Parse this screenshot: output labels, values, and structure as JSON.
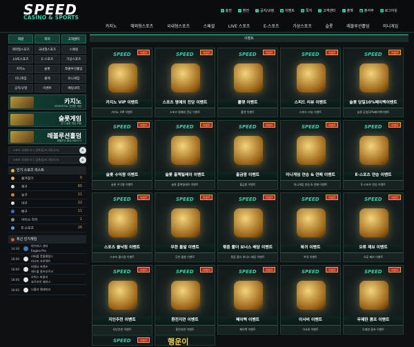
{
  "logo": {
    "main": "SPEED",
    "sub": "CASINO & SPORTS"
  },
  "top_menu": [
    "충전",
    "환전",
    "공지/규정",
    "이벤트",
    "쪽지",
    "고객센터",
    "출첵",
    "출석부",
    "로그아웃"
  ],
  "nav": [
    "카지노",
    "해외형스포츠",
    "국내형스포츠",
    "스페셜",
    "LIVE 스포츠",
    "E-스포츠",
    "가상스포츠",
    "슬롯",
    "레볼루션홀덤",
    "미니게임"
  ],
  "sidebar": {
    "top_buttons": [
      "회원",
      "쪽지",
      "고객센터"
    ],
    "grid": [
      "해외형스포츠",
      "국내형스포츠",
      "스페셜",
      "LIVE스포츠",
      "E-스포츠",
      "가상스포츠",
      "카지노",
      "슬롯",
      "레볼루션홀덤",
      "미니게임",
      "출첵",
      "미니게임",
      "공지/규정",
      "이벤트",
      "배팅내역"
    ],
    "promos": [
      {
        "title": "카지노",
        "sub": "라이브카지노 안전한 게임"
      },
      {
        "title": "슬롯게임",
        "sub": "인기 슬롯 게임 모음"
      },
      {
        "title": "레볼루션홀덤",
        "sub": "레볼루션 홀덤 바로가기"
      }
    ],
    "search": [
      "스포츠 국내외 리그 검색(팀/리그명/국가)",
      "스포츠 국내외 리그 검색(팀/리그명/국가)"
    ],
    "sports_header": "인기 스포츠 리스트",
    "sports": [
      {
        "name": "즐겨찾기",
        "count": "0"
      },
      {
        "name": "축구",
        "count": "65"
      },
      {
        "name": "농구",
        "count": "11"
      },
      {
        "name": "야구",
        "count": "22"
      },
      {
        "name": "배구",
        "count": "11"
      },
      {
        "name": "아이스 하키",
        "count": "1"
      },
      {
        "name": "E-스포츠",
        "count": "26"
      }
    ],
    "games_header": "최신 인기게임",
    "games": [
      {
        "time": "14:30",
        "team1": "바이러스 센터",
        "team2": "Eagles-Pro"
      },
      {
        "time": "18:00",
        "team1": "리버풀 풋볼클럽스",
        "team2": "미나미 프로젝트"
      },
      {
        "time": "18:00",
        "team1": "비엔나 프렌즈",
        "team2": "레드불 잘츠부르크"
      },
      {
        "time": "18:00",
        "team1": "오빅스 바둘리",
        "team2": "요르카이 헤어스"
      },
      {
        "time": "18:00",
        "team1": "나폴라 엘레미터"
      }
    ]
  },
  "main": {
    "title": "이벤트",
    "cards": [
      {
        "title": "카지노 VIP 이벤트",
        "sub": "카지노 VIP 이벤트",
        "badge": "이벤트"
      },
      {
        "title": "스포츠 명예의 전당 이벤트",
        "sub": "스포츠 명예의 전당 이벤트",
        "badge": "이벤트"
      },
      {
        "title": "룰렛 이벤트",
        "sub": "룰렛 이벤트",
        "badge": "이벤트"
      },
      {
        "title": "스피드 리뷰 이벤트",
        "sub": "스피드 리뷰 이벤트",
        "badge": "이벤트"
      },
      {
        "title": "슬롯 당일10%페이백이벤트",
        "sub": "슬롯 당일10%페이백이벤트",
        "badge": "이벤트"
      },
      {
        "title": "슬롯 수익왕 이벤트",
        "sub": "슬롯 수익왕 이벤트",
        "badge": "이벤트"
      },
      {
        "title": "슬롯 출첵릴레이 이벤트",
        "sub": "슬롯 출첵릴레이 이벤트",
        "badge": "이벤트"
      },
      {
        "title": "출금왕 이벤트",
        "sub": "출금왕 이벤트",
        "badge": "이벤트"
      },
      {
        "title": "미니게임 연승 & 연패 이벤트",
        "sub": "미니게임 연승 & 연패 이벤트",
        "badge": "이벤트"
      },
      {
        "title": "E-스포츠 연승 이벤트",
        "sub": "E-스포츠 연승 이벤트",
        "badge": "이벤트"
      },
      {
        "title": "스포츠 올낙첨 이벤트",
        "sub": "스포츠 올낙첨 이벤트",
        "badge": "이벤트"
      },
      {
        "title": "무한 돌발 이벤트",
        "sub": "무한 돌발 이벤트",
        "badge": "이벤트"
      },
      {
        "title": "묶음 폴더 보너스 배당 이벤트",
        "sub": "묶음 폴더 보너스 배당 이벤트",
        "badge": "이벤트"
      },
      {
        "title": "복귀 이벤트",
        "sub": "복귀 이벤트",
        "badge": "이벤트"
      },
      {
        "title": "오류 제보 이벤트",
        "sub": "오류 제보 이벤트",
        "badge": "이벤트"
      },
      {
        "title": "지인추천 이벤트",
        "sub": "지인추천 이벤트",
        "badge": "이벤트"
      },
      {
        "title": "환전지연 이벤트",
        "sub": "환전지연 이벤트",
        "badge": "이벤트"
      },
      {
        "title": "페이백 이벤트",
        "sub": "페이백 이벤트",
        "badge": "이벤트"
      },
      {
        "title": "이사비 이벤트",
        "sub": "이사비 이벤트",
        "badge": "이벤트"
      },
      {
        "title": "무제한 콤프 이벤트",
        "sub": "무제한 콤프 이벤트",
        "badge": "이벤트"
      }
    ],
    "peek": [
      {
        "badge": "이벤트",
        "text": ""
      },
      {
        "badge": "",
        "text": "행운이"
      }
    ]
  }
}
